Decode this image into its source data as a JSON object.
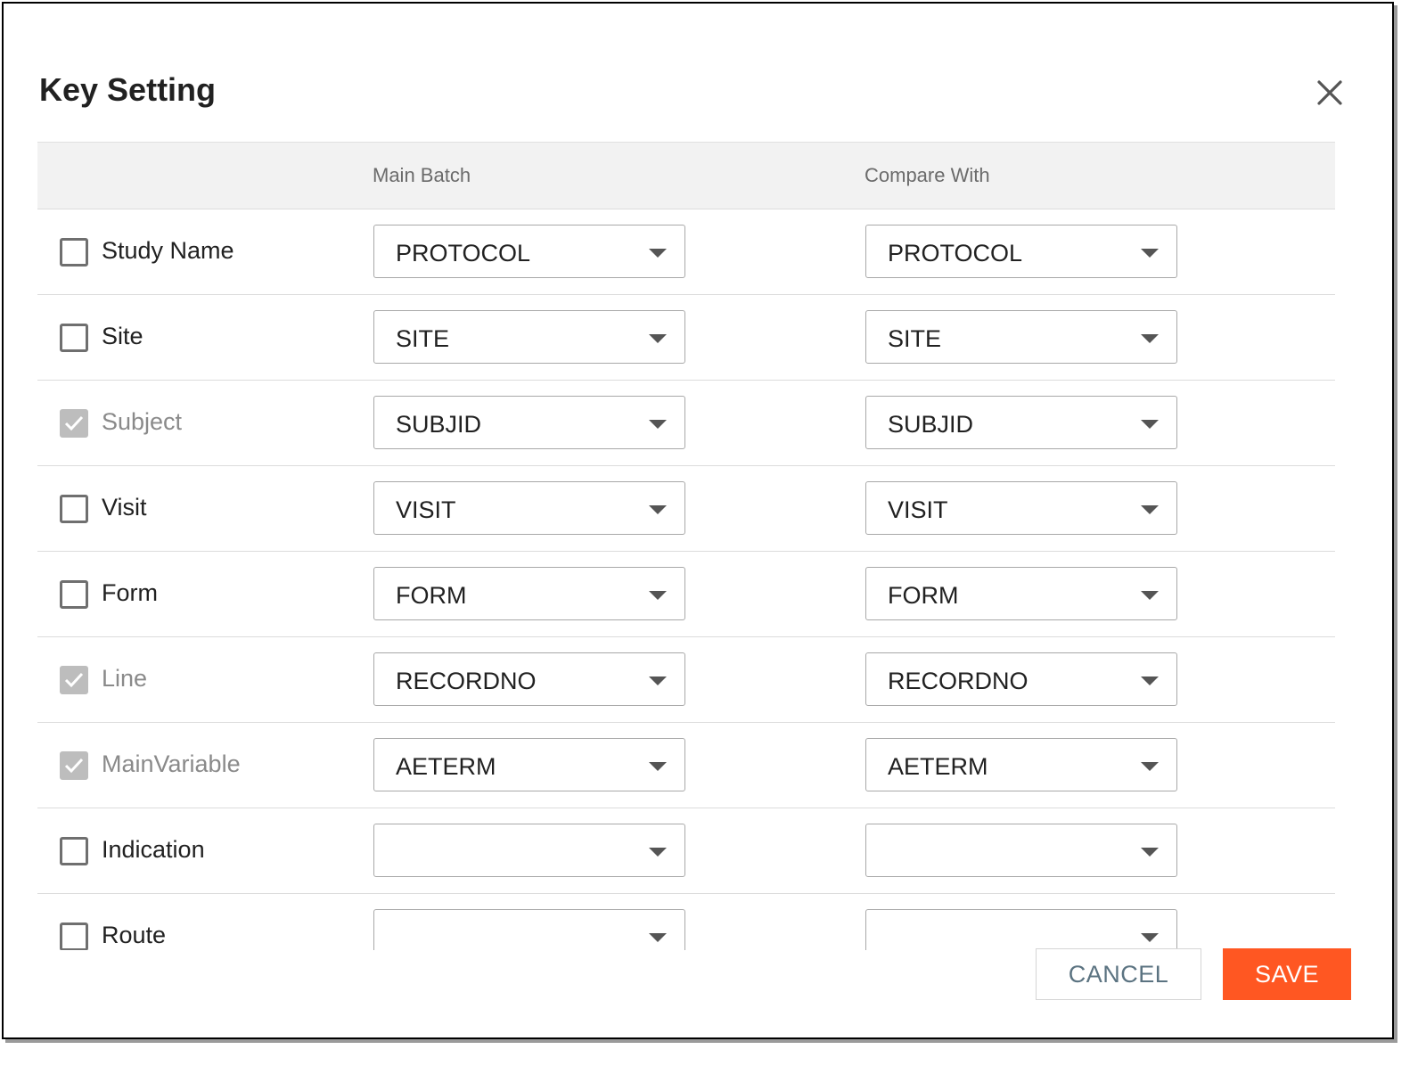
{
  "dialog": {
    "title": "Key Setting",
    "close_icon": "close-icon"
  },
  "table": {
    "headers": {
      "key": "",
      "main_batch": "Main Batch",
      "compare_with": "Compare With"
    },
    "rows": [
      {
        "label": "Study Name",
        "checked": false,
        "disabled": false,
        "main": "PROTOCOL",
        "compare": "PROTOCOL"
      },
      {
        "label": "Site",
        "checked": false,
        "disabled": false,
        "main": "SITE",
        "compare": "SITE"
      },
      {
        "label": "Subject",
        "checked": true,
        "disabled": true,
        "main": "SUBJID",
        "compare": "SUBJID"
      },
      {
        "label": "Visit",
        "checked": false,
        "disabled": false,
        "main": "VISIT",
        "compare": "VISIT"
      },
      {
        "label": "Form",
        "checked": false,
        "disabled": false,
        "main": "FORM",
        "compare": "FORM"
      },
      {
        "label": "Line",
        "checked": true,
        "disabled": true,
        "main": "RECORDNO",
        "compare": "RECORDNO"
      },
      {
        "label": "MainVariable",
        "checked": true,
        "disabled": true,
        "main": "AETERM",
        "compare": "AETERM"
      },
      {
        "label": "Indication",
        "checked": false,
        "disabled": false,
        "main": "",
        "compare": ""
      },
      {
        "label": "Route",
        "checked": false,
        "disabled": false,
        "main": "",
        "compare": ""
      }
    ]
  },
  "actions": {
    "cancel_label": "CANCEL",
    "save_label": "SAVE"
  },
  "colors": {
    "accent": "#ff5722",
    "cancel_text": "#5b7381",
    "checked_fill": "#bdbdbd"
  }
}
